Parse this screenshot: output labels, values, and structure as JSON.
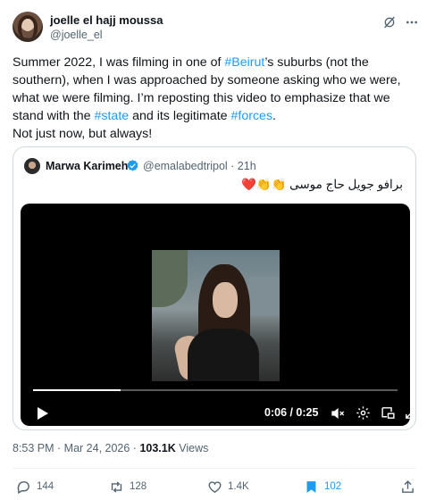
{
  "author": {
    "name": "joelle el hajj moussa",
    "handle": "@joelle_el"
  },
  "body": {
    "t1": "Summer 2022, I was filming in one of ",
    "tag1": "#Beirut",
    "t2": "’s suburbs (not the southern), when I was approached by someone asking who we were, what we were filming. I’m reposting this video to emphasize that we stand with the ",
    "tag2": "#state",
    "t3": " and its legitimate ",
    "tag3": "#forces",
    "t4": ".",
    "line2": "Not just now, but always!"
  },
  "quote": {
    "name": "Marwa Karimeh",
    "handle": "@emalabedtripol · 21h",
    "text": "برافو جويل حاج موسى 👏👏❤️"
  },
  "video": {
    "time": "0:06 / 0:25",
    "progress": 0.24
  },
  "meta": {
    "timestamp": "8:53 PM · Mar 24, 2026 · ",
    "views_count": "103.1K",
    "views_label": " Views"
  },
  "actions": {
    "replies": "144",
    "reposts": "128",
    "likes": "1.4K",
    "bookmarks": "102"
  },
  "colors": {
    "accent": "#1d9bf0",
    "text": "#0f1419",
    "secondary": "#536471",
    "border": "#cfd9de"
  }
}
